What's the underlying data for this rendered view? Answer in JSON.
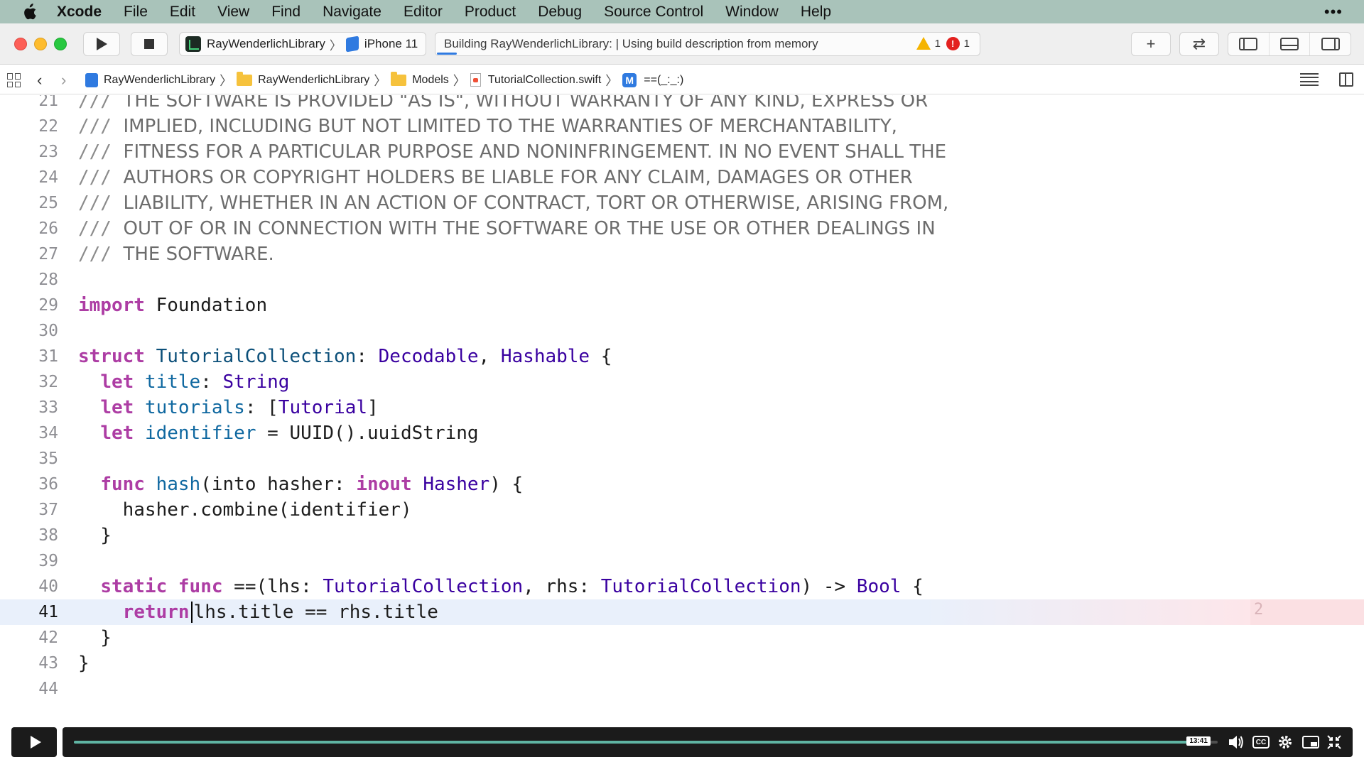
{
  "menubar": {
    "app_name": "Xcode",
    "items": [
      "File",
      "Edit",
      "View",
      "Find",
      "Navigate",
      "Editor",
      "Product",
      "Debug",
      "Source Control",
      "Window",
      "Help"
    ],
    "more": "•••"
  },
  "toolbar": {
    "scheme_target": "RayWenderlichLibrary",
    "scheme_device": "iPhone 11",
    "activity_text": "Building RayWenderlichLibrary:  | Using build description from memory",
    "warning_count": "1",
    "error_count": "1",
    "plus": "+",
    "swap": "⇄"
  },
  "jumpbar": {
    "back": "‹",
    "forward": "›",
    "crumbs": [
      "RayWenderlichLibrary",
      "RayWenderlichLibrary",
      "Models",
      "TutorialCollection.swift",
      "==(_:_:)"
    ],
    "method_badge": "M"
  },
  "editor": {
    "lines": [
      {
        "num": "21",
        "comment": "THE SOFTWARE IS PROVIDED \"AS IS\", WITHOUT WARRANTY OF ANY KIND, EXPRESS OR"
      },
      {
        "num": "22",
        "comment": "IMPLIED, INCLUDING BUT NOT LIMITED TO THE WARRANTIES OF MERCHANTABILITY,"
      },
      {
        "num": "23",
        "comment": "FITNESS FOR A PARTICULAR PURPOSE AND NONINFRINGEMENT. IN NO EVENT SHALL THE"
      },
      {
        "num": "24",
        "comment": "AUTHORS OR COPYRIGHT HOLDERS BE LIABLE FOR ANY CLAIM, DAMAGES OR OTHER"
      },
      {
        "num": "25",
        "comment": "LIABILITY, WHETHER IN AN ACTION OF CONTRACT, TORT OR OTHERWISE, ARISING FROM,"
      },
      {
        "num": "26",
        "comment": "OUT OF OR IN CONNECTION WITH THE SOFTWARE OR THE USE OR OTHER DEALINGS IN"
      },
      {
        "num": "27",
        "comment": "THE SOFTWARE."
      },
      {
        "num": "28"
      },
      {
        "num": "29"
      },
      {
        "num": "30"
      },
      {
        "num": "31"
      },
      {
        "num": "32"
      },
      {
        "num": "33"
      },
      {
        "num": "34"
      },
      {
        "num": "35"
      },
      {
        "num": "36"
      },
      {
        "num": "37"
      },
      {
        "num": "38"
      },
      {
        "num": "39"
      },
      {
        "num": "40"
      },
      {
        "num": "41"
      },
      {
        "num": "42"
      },
      {
        "num": "43"
      },
      {
        "num": "44"
      }
    ],
    "comment_prefix": "///",
    "tokens": {
      "import": "import",
      "foundation": "Foundation",
      "struct": "struct",
      "type_name": "TutorialCollection",
      "decodable": "Decodable",
      "hashable": "Hashable",
      "let": "let",
      "title": "title",
      "string": "String",
      "tutorials": "tutorials",
      "tutorial_type": "Tutorial",
      "identifier": "identifier",
      "uuid_expr": "UUID().uuidString",
      "func": "func",
      "hash": "hash",
      "into_hasher": "(into hasher: ",
      "inout": "inout",
      "hasher_type": "Hasher",
      "combine_line": "hasher.combine(identifier)",
      "static": "static",
      "eq_op": "==(lhs: ",
      "rhs_label": ", rhs: ",
      "arrow": ") -> ",
      "bool": "Bool",
      "return": "return",
      "return_expr": "lhs.title == rhs.title"
    },
    "current_line": "41",
    "issue_count": "2"
  },
  "player": {
    "current_time": "13:41",
    "progress": 0.994
  }
}
